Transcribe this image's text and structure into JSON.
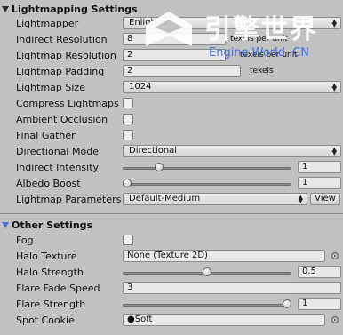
{
  "lightmapping": {
    "title": "Lightmapping Settings",
    "lightmapper": {
      "label": "Lightmapper",
      "value": "Enlighten"
    },
    "indirect_resolution": {
      "label": "Indirect Resolution",
      "value": "8",
      "unit": "texels per unit"
    },
    "lightmap_resolution": {
      "label": "Lightmap Resolution",
      "value": "2",
      "unit": "texels per unit"
    },
    "lightmap_padding": {
      "label": "Lightmap Padding",
      "value": "2",
      "unit": "texels"
    },
    "lightmap_size": {
      "label": "Lightmap Size",
      "value": "1024"
    },
    "compress_lightmaps": {
      "label": "Compress Lightmaps",
      "checked": false
    },
    "ambient_occlusion": {
      "label": "Ambient Occlusion",
      "checked": false
    },
    "final_gather": {
      "label": "Final Gather",
      "checked": false
    },
    "directional_mode": {
      "label": "Directional Mode",
      "value": "Directional"
    },
    "indirect_intensity": {
      "label": "Indirect Intensity",
      "value": "1",
      "slider_fraction": 0.2
    },
    "albedo_boost": {
      "label": "Albedo Boost",
      "value": "1",
      "slider_fraction": 0.0
    },
    "lightmap_parameters": {
      "label": "Lightmap Parameters",
      "value": "Default-Medium",
      "view_label": "View"
    }
  },
  "other": {
    "title": "Other Settings",
    "fog": {
      "label": "Fog",
      "checked": false
    },
    "halo_texture": {
      "label": "Halo Texture",
      "value": "None (Texture 2D)"
    },
    "halo_strength": {
      "label": "Halo Strength",
      "value": "0.5",
      "slider_fraction": 0.5
    },
    "flare_fade_speed": {
      "label": "Flare Fade Speed",
      "value": "3"
    },
    "flare_strength": {
      "label": "Flare Strength",
      "value": "1",
      "slider_fraction": 1.0
    },
    "spot_cookie": {
      "label": "Spot Cookie",
      "value": "Soft",
      "bullet": "●"
    }
  },
  "watermark": {
    "cn": "引擎世界",
    "en": "Engine World .CN"
  }
}
